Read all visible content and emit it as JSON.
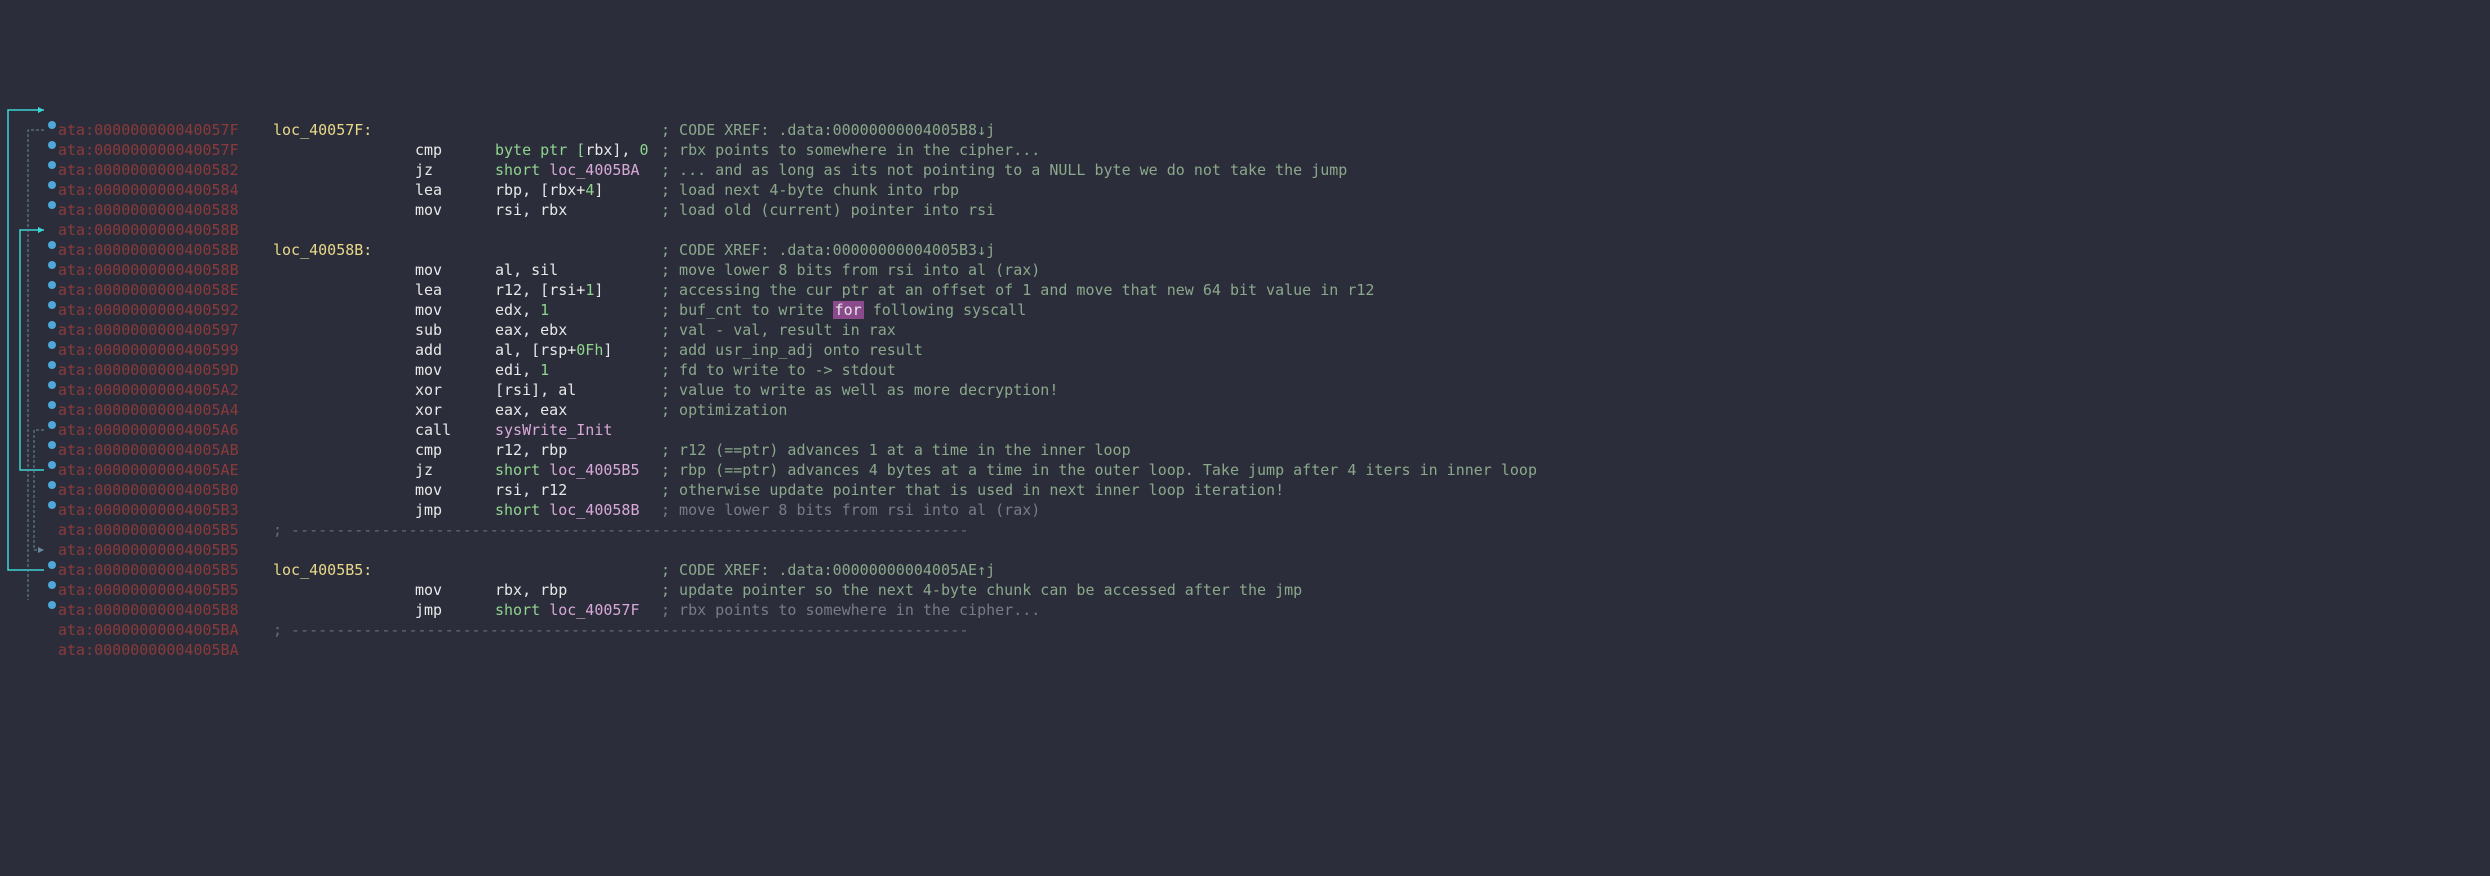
{
  "segment_prefix": "ata:",
  "lines": [
    {
      "addr": "000000000040057F",
      "bp": true,
      "label": "loc_40057F:",
      "mnemonic": "",
      "operands": [],
      "comment_prefix": "; CODE XREF: ",
      "xref": ".data:00000000004005B8↓j"
    },
    {
      "addr": "000000000040057F",
      "bp": true,
      "mnemonic": "cmp",
      "operands": [
        "byte ptr [",
        "rbx",
        "], ",
        "0"
      ],
      "comment": "; rbx points to somewhere in the cipher..."
    },
    {
      "addr": "0000000000400582",
      "bp": true,
      "mnemonic": "jz",
      "operands": [
        "short ",
        "loc_4005BA"
      ],
      "symbol": "loc_4005BA",
      "comment": "; ... and as long as its not pointing to a NULL byte we do not take the jump"
    },
    {
      "addr": "0000000000400584",
      "bp": true,
      "mnemonic": "lea",
      "operands": [
        "rbp",
        ", [",
        "rbx",
        "+",
        "4",
        "]"
      ],
      "comment": "; load next 4-byte chunk into rbp"
    },
    {
      "addr": "0000000000400588",
      "bp": true,
      "mnemonic": "mov",
      "operands": [
        "rsi",
        ", ",
        "rbx"
      ],
      "comment": "; load old (current) pointer into rsi"
    },
    {
      "addr": "000000000040058B",
      "bp": false,
      "blank": true
    },
    {
      "addr": "000000000040058B",
      "bp": true,
      "label": "loc_40058B:",
      "mnemonic": "",
      "operands": [],
      "comment_prefix": "; CODE XREF: ",
      "xref": ".data:00000000004005B3↓j"
    },
    {
      "addr": "000000000040058B",
      "bp": true,
      "mnemonic": "mov",
      "operands": [
        "al",
        ", ",
        "sil"
      ],
      "comment": "; move lower 8 bits from rsi into al (rax)"
    },
    {
      "addr": "000000000040058E",
      "bp": true,
      "mnemonic": "lea",
      "operands": [
        "r12",
        ", [",
        "rsi",
        "+",
        "1",
        "]"
      ],
      "comment": "; accessing the cur ptr at an offset of 1 and move that new 64 bit value in r12"
    },
    {
      "addr": "0000000000400592",
      "bp": true,
      "mnemonic": "mov",
      "operands": [
        "edx",
        ", ",
        "1"
      ],
      "comment_parts": [
        "; buf_cnt to write ",
        "for",
        " following syscall"
      ],
      "highlight_idx": 1
    },
    {
      "addr": "0000000000400597",
      "bp": true,
      "mnemonic": "sub",
      "operands": [
        "eax",
        ", ",
        "ebx"
      ],
      "comment": "; val - val, result in rax"
    },
    {
      "addr": "0000000000400599",
      "bp": true,
      "mnemonic": "add",
      "operands": [
        "al",
        ", [",
        "rsp",
        "+",
        "0Fh",
        "]"
      ],
      "comment": "; add usr_inp_adj onto result"
    },
    {
      "addr": "000000000040059D",
      "bp": true,
      "mnemonic": "mov",
      "operands": [
        "edi",
        ", ",
        "1"
      ],
      "comment": "; fd to write to -> stdout"
    },
    {
      "addr": "00000000004005A2",
      "bp": true,
      "mnemonic": "xor",
      "operands": [
        "[",
        "rsi",
        "], ",
        "al"
      ],
      "comment": "; value to write as well as more decryption!"
    },
    {
      "addr": "00000000004005A4",
      "bp": true,
      "mnemonic": "xor",
      "operands": [
        "eax",
        ", ",
        "eax"
      ],
      "comment": "; optimization"
    },
    {
      "addr": "00000000004005A6",
      "bp": true,
      "mnemonic": "call",
      "operands": [],
      "symbol": "sysWrite_Init"
    },
    {
      "addr": "00000000004005AB",
      "bp": true,
      "mnemonic": "cmp",
      "operands": [
        "r12",
        ", ",
        "rbp"
      ],
      "comment": "; r12 (==ptr) advances 1 at a time in the inner loop"
    },
    {
      "addr": "00000000004005AE",
      "bp": true,
      "mnemonic": "jz",
      "operands": [
        "short ",
        "loc_4005B5"
      ],
      "symbol": "loc_4005B5",
      "comment": "; rbp (==ptr) advances 4 bytes at a time in the outer loop. Take jump after 4 iters in inner loop"
    },
    {
      "addr": "00000000004005B0",
      "bp": true,
      "mnemonic": "mov",
      "operands": [
        "rsi",
        ", ",
        "r12"
      ],
      "comment": "; otherwise update pointer that is used in next inner loop iteration!"
    },
    {
      "addr": "00000000004005B3",
      "bp": true,
      "mnemonic": "jmp",
      "operands": [
        "short ",
        "loc_40058B"
      ],
      "symbol": "loc_40058B",
      "comment_faded": "; move lower 8 bits from rsi into al (rax)"
    },
    {
      "addr": "00000000004005B5",
      "bp": false,
      "dash": true,
      "dash_prefix": "; "
    },
    {
      "addr": "00000000004005B5",
      "bp": false,
      "blank": true
    },
    {
      "addr": "00000000004005B5",
      "bp": true,
      "label": "loc_4005B5:",
      "mnemonic": "",
      "operands": [],
      "comment_prefix": "; CODE XREF: ",
      "xref": ".data:00000000004005AE↑j"
    },
    {
      "addr": "00000000004005B5",
      "bp": true,
      "mnemonic": "mov",
      "operands": [
        "rbx",
        ", ",
        "rbp"
      ],
      "comment": "; update pointer so the next 4-byte chunk can be accessed after the jmp"
    },
    {
      "addr": "00000000004005B8",
      "bp": true,
      "mnemonic": "jmp",
      "operands": [
        "short ",
        "loc_40057F"
      ],
      "symbol": "loc_40057F",
      "comment_faded": "; rbx points to somewhere in the cipher..."
    },
    {
      "addr": "00000000004005BA",
      "bp": false,
      "dash": true,
      "dash_prefix": "; "
    },
    {
      "addr": "00000000004005BA",
      "bp": false,
      "blank": true
    }
  ],
  "dashes": "---------------------------------------------------------------------------"
}
